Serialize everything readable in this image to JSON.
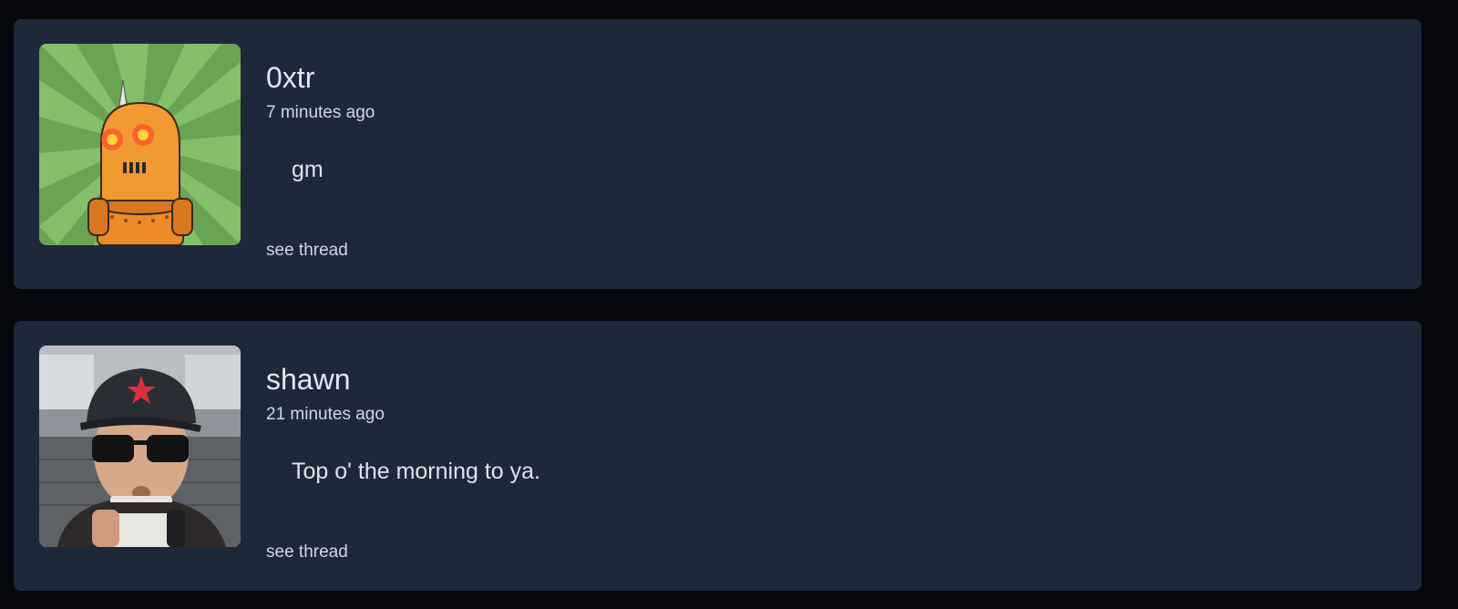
{
  "posts": [
    {
      "username": "0xtr",
      "time": "7 minutes ago",
      "content": "gm",
      "thread_link": "see thread",
      "avatar_icon": "robot-avatar-icon",
      "colors": {
        "avatar_bg": "#6aa352",
        "robot": "#f0902a"
      }
    },
    {
      "username": "shawn",
      "time": "21 minutes ago",
      "content": "Top o' the morning to ya.",
      "thread_link": "see thread",
      "avatar_icon": "person-avatar-photo",
      "colors": {
        "hat": "#2a2d33",
        "star": "#d8313b"
      }
    }
  ],
  "colors": {
    "page_bg": "#05070d",
    "card_bg": "#1e283b",
    "text_primary": "#e3e8f0",
    "text_secondary": "#d2d8e2"
  }
}
